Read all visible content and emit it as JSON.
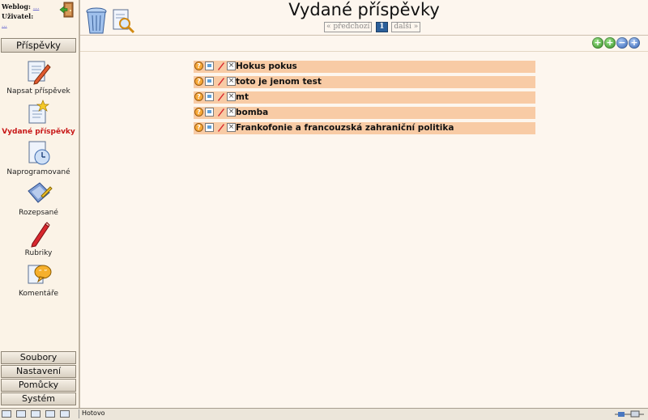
{
  "user": {
    "weblog_label": "Weblog:",
    "weblog_value": "...",
    "user_label": "Uživatel:",
    "user_value": "..."
  },
  "sidebar": {
    "top_group": "Příspěvky",
    "items": [
      {
        "label": "Napsat příspěvek",
        "icon": "write-post-icon",
        "active": false
      },
      {
        "label": "Vydané příspěvky",
        "icon": "published-posts-icon",
        "active": true
      },
      {
        "label": "Naprogramované",
        "icon": "scheduled-icon",
        "active": false
      },
      {
        "label": "Rozepsané",
        "icon": "drafts-icon",
        "active": false
      },
      {
        "label": "Rubriky",
        "icon": "categories-icon",
        "active": false
      },
      {
        "label": "Komentáře",
        "icon": "comments-icon",
        "active": false
      }
    ],
    "bottom_groups": [
      "Soubory",
      "Nastavení",
      "Pomůcky",
      "Systém"
    ]
  },
  "header": {
    "title": "Vydané příspěvky",
    "pager": {
      "prev": "« předchozí",
      "current": "1",
      "next": "další »"
    },
    "icons": [
      "trash-icon",
      "search-document-icon"
    ]
  },
  "actions": [
    {
      "name": "add-green",
      "glyph": "+",
      "icon": "plus-green-icon"
    },
    {
      "name": "add-green-2",
      "glyph": "+",
      "icon": "plus-green-icon"
    },
    {
      "name": "remove-blue",
      "glyph": "−",
      "icon": "minus-blue-icon"
    },
    {
      "name": "add-blue",
      "glyph": "+",
      "icon": "plus-blue-icon"
    }
  ],
  "posts": [
    {
      "title": "Hokus pokus"
    },
    {
      "title": "toto je jenom test"
    },
    {
      "title": "mt"
    },
    {
      "title": "bomba"
    },
    {
      "title": "Frankofonie a francouzská zahraniční politika"
    }
  ],
  "status": {
    "text": "Hotovo"
  },
  "colors": {
    "post_row": "#f8cba5",
    "active_nav": "#c81818",
    "page_bg": "#fdf6ee"
  }
}
